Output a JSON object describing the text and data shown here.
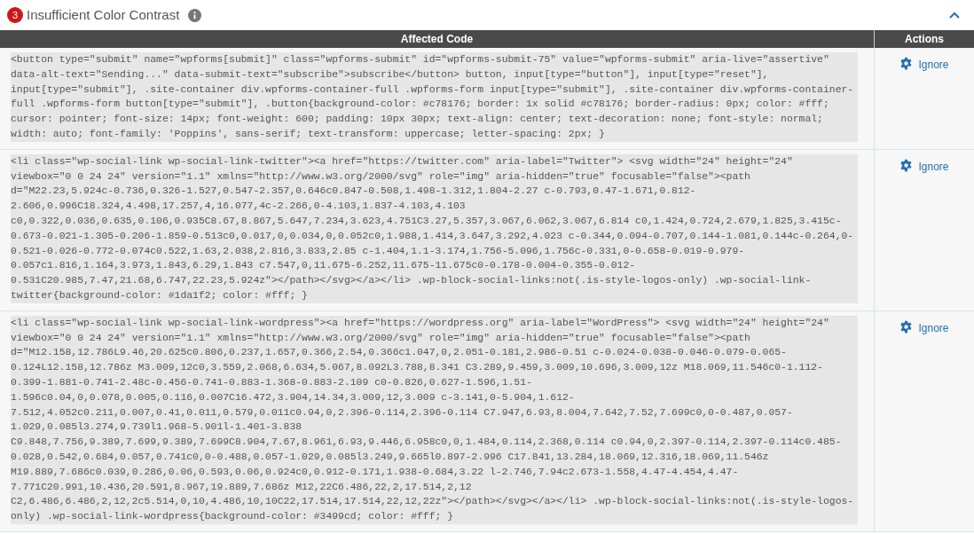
{
  "section": {
    "count": "3",
    "title": "Insufficient Color Contrast"
  },
  "table": {
    "columns": [
      "Affected Code",
      "Actions"
    ],
    "rows": [
      {
        "code": "<button type=\"submit\" name=\"wpforms[submit]\" class=\"wpforms-submit\" id=\"wpforms-submit-75\" value=\"wpforms-submit\" aria-live=\"assertive\" data-alt-text=\"Sending...\" data-submit-text=\"subscribe\">subscribe</button> button, input[type=\"button\"], input[type=\"reset\"], input[type=\"submit\"], .site-container div.wpforms-container-full .wpforms-form input[type=\"submit\"], .site-container div.wpforms-container-full .wpforms-form button[type=\"submit\"], .button{background-color: #c78176; border: 1x solid #c78176; border-radius: 0px; color: #fff; cursor: pointer; font-size: 14px; font-weight: 600; padding: 10px 30px; text-align: center; text-decoration: none; font-style: normal; width: auto; font-family: 'Poppins', sans-serif; text-transform: uppercase; letter-spacing: 2px; }",
        "action": "Ignore"
      },
      {
        "code": "<li class=\"wp-social-link wp-social-link-twitter\"><a href=\"https://twitter.com\" aria-label=\"Twitter\"> <svg width=\"24\" height=\"24\" viewbox=\"0 0 24 24\" version=\"1.1\" xmlns=\"http://www.w3.org/2000/svg\" role=\"img\" aria-hidden=\"true\" focusable=\"false\"><path d=\"M22.23,5.924c-0.736,0.326-1.527,0.547-2.357,0.646c0.847-0.508,1.498-1.312,1.804-2.27 c-0.793,0.47-1.671,0.812-2.606,0.996C18.324,4.498,17.257,4,16.077,4c-2.266,0-4.103,1.837-4.103,4.103 c0,0.322,0.036,0.635,0.106,0.935C8.67,8.867,5.647,7.234,3.623,4.751C3.27,5.357,3.067,6.062,3.067,6.814 c0,1.424,0.724,2.679,1.825,3.415c-0.673-0.021-1.305-0.206-1.859-0.513c0,0.017,0,0.034,0,0.052c0,1.988,1.414,3.647,3.292,4.023 c-0.344,0.094-0.707,0.144-1.081,0.144c-0.264,0-0.521-0.026-0.772-0.074c0.522,1.63,2.038,2.816,3.833,2.85 c-1.404,1.1-3.174,1.756-5.096,1.756c-0.331,0-0.658-0.019-0.979-0.057c1.816,1.164,3.973,1.843,6.29,1.843 c7.547,0,11.675-6.252,11.675-11.675c0-0.178-0.004-0.355-0.012-0.531C20.985,7.47,21.68,6.747,22.23,5.924z\"></path></svg></a></li> .wp-block-social-links:not(.is-style-logos-only) .wp-social-link-twitter{background-color: #1da1f2; color: #fff; }",
        "action": "Ignore"
      },
      {
        "code": "<li class=\"wp-social-link wp-social-link-wordpress\"><a href=\"https://wordpress.org\" aria-label=\"WordPress\"> <svg width=\"24\" height=\"24\" viewbox=\"0 0 24 24\" version=\"1.1\" xmlns=\"http://www.w3.org/2000/svg\" role=\"img\" aria-hidden=\"true\" focusable=\"false\"><path d=\"M12.158,12.786L9.46,20.625c0.806,0.237,1.657,0.366,2.54,0.366c1.047,0,2.051-0.181,2.986-0.51 c-0.024-0.038-0.046-0.079-0.065-0.124L12.158,12.786z M3.009,12c0,3.559,2.068,6.634,5.067,8.092L3.788,8.341 C3.289,9.459,3.009,10.696,3.009,12z M18.069,11.546c0-1.112-0.399-1.881-0.741-2.48c-0.456-0.741-0.883-1.368-0.883-2.109 c0-0.826,0.627-1.596,1.51-1.596c0.04,0,0.078,0.005,0.116,0.007C16.472,3.904,14.34,3.009,12,3.009 c-3.141,0-5.904,1.612-7.512,4.052c0.211,0.007,0.41,0.011,0.579,0.011c0.94,0,2.396-0.114,2.396-0.114 C7.947,6.93,8.004,7.642,7.52,7.699c0,0-0.487,0.057-1.029,0.085l3.274,9.739l1.968-5.901l-1.401-3.838 C9.848,7.756,9.389,7.699,9.389,7.699C8.904,7.67,8.961,6.93,9.446,6.958c0,0,1.484,0.114,2.368,0.114 c0.94,0,2.397-0.114,2.397-0.114c0.485-0.028,0.542,0.684,0.057,0.741c0,0-0.488,0.057-1.029,0.085l3.249,9.665l0.897-2.996 C17.841,13.284,18.069,12.316,18.069,11.546z M19.889,7.686c0.039,0.286,0.06,0.593,0.06,0.924c0,0.912-0.171,1.938-0.684,3.22 l-2.746,7.94c2.673-1.558,4.47-4.454,4.47-7.771C20.991,10.436,20.591,8.967,19.889,7.686z M12,22C6.486,22,2,17.514,2,12 C2,6.486,6.486,2,12,2c5.514,0,10,4.486,10,10C22,17.514,17.514,22,12,22z\"></path></svg></a></li> .wp-block-social-links:not(.is-style-logos-only) .wp-social-link-wordpress{background-color: #3499cd; color: #fff; }",
        "action": "Ignore"
      }
    ]
  }
}
